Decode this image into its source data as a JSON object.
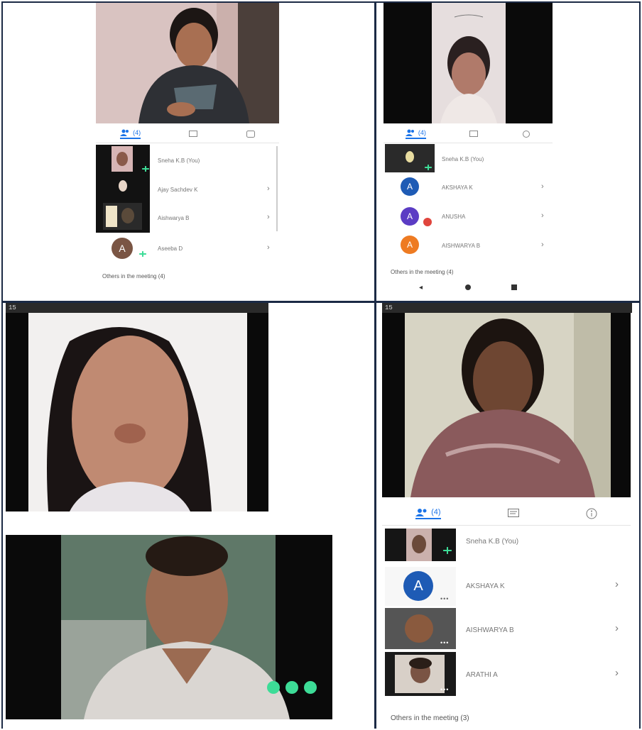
{
  "quadrant_tl": {
    "tabs": [
      {
        "label": "(4)"
      },
      {
        "label": ""
      },
      {
        "label": ""
      }
    ],
    "participants": [
      {
        "name": "Sneha K.B (You)"
      },
      {
        "name": "Ajay Sachdev K"
      },
      {
        "name": "Aishwarya B"
      },
      {
        "name": "Aseeba D"
      }
    ],
    "avatar_letter": "A",
    "others_label": "Others in the meeting (4)"
  },
  "quadrant_tr": {
    "tabs": [
      {
        "label": "(4)"
      },
      {
        "label": ""
      },
      {
        "label": ""
      }
    ],
    "participants": [
      {
        "name": "Sneha K.B (You)"
      },
      {
        "name": "AKSHAYA K"
      },
      {
        "name": "ANUSHA"
      },
      {
        "name": "AISHWARYA B"
      }
    ],
    "avatars": [
      {
        "letter": "A",
        "color": "#1e5bb5"
      },
      {
        "letter": "A",
        "color": "#5b3cc4"
      },
      {
        "letter": "A",
        "color": "#ee7b22"
      }
    ],
    "others_label": "Others in the meeting (4)"
  },
  "quadrant_br": {
    "status_time": "15",
    "tabs": [
      {
        "label": "(4)"
      },
      {
        "label": ""
      },
      {
        "label": ""
      }
    ],
    "participants": [
      {
        "name": "Sneha K.B (You)"
      },
      {
        "name": "AKSHAYA K"
      },
      {
        "name": "AISHWARYA B"
      },
      {
        "name": "ARATHI A"
      }
    ],
    "avatar_letter": "A",
    "others_label": "Others in the meeting (3)"
  },
  "quadrant_bl": {
    "status_time": "15"
  },
  "colors": {
    "accent": "#1a73e8",
    "teal": "#3ddc97",
    "dark_border": "#1b2a45"
  }
}
